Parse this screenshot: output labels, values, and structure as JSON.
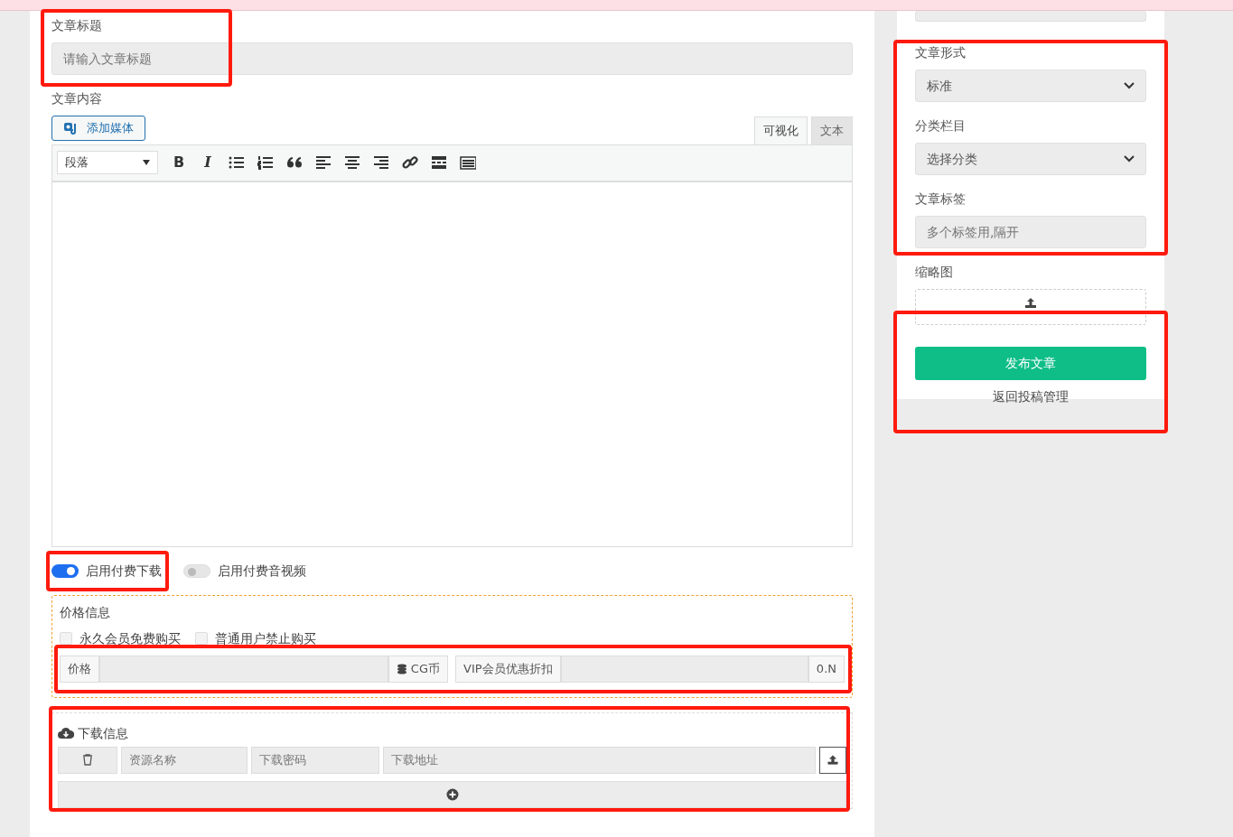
{
  "title_field": {
    "label": "文章标题",
    "placeholder": "请输入文章标题",
    "annotated": true
  },
  "content": {
    "label": "文章内容",
    "add_media_button": "添加媒体",
    "tabs": [
      {
        "label": "可视化",
        "selected": true
      },
      {
        "label": "文本",
        "selected": false
      }
    ],
    "format_select": "段落",
    "tools": [
      {
        "kind": "bold",
        "text": "B"
      },
      {
        "kind": "italic",
        "text": "I"
      },
      {
        "kind": "bullet-list"
      },
      {
        "kind": "numbered-list"
      },
      {
        "kind": "quote"
      },
      {
        "kind": "align-left"
      },
      {
        "kind": "align-center"
      },
      {
        "kind": "align-right"
      },
      {
        "kind": "link"
      },
      {
        "kind": "read-more"
      },
      {
        "kind": "keyboard"
      }
    ]
  },
  "toggles": [
    {
      "label": "启用付费下载",
      "on": true,
      "annotated": true
    },
    {
      "label": "启用付费音视频",
      "on": false,
      "annotated": false
    }
  ],
  "price_info": {
    "title": "价格信息",
    "checkboxes": [
      {
        "label": "永久会员免费购买",
        "checked": false
      },
      {
        "label": "普通用户禁止购买",
        "checked": false
      }
    ],
    "price_label": "价格",
    "currency": "CG币",
    "discount_label": "VIP会员优惠折扣",
    "discount_suffix": "0.N",
    "annotated": true
  },
  "download_info": {
    "title": "下载信息",
    "rows": [
      {
        "name_placeholder": "资源名称",
        "password_placeholder": "下载密码",
        "url_placeholder": "下载地址"
      }
    ],
    "annotated": true
  },
  "sidebar": {
    "fields": [
      {
        "kind": "select",
        "label": "文章形式",
        "value": "标准"
      },
      {
        "kind": "select",
        "label": "分类栏目",
        "value": "选择分类"
      },
      {
        "kind": "input",
        "label": "文章标签",
        "placeholder": "多个标签用,隔开"
      }
    ],
    "fields_annotated": true,
    "thumbnail_label": "缩略图",
    "publish_button": "发布文章",
    "back_link": "返回投稿管理",
    "actions_annotated": true
  }
}
